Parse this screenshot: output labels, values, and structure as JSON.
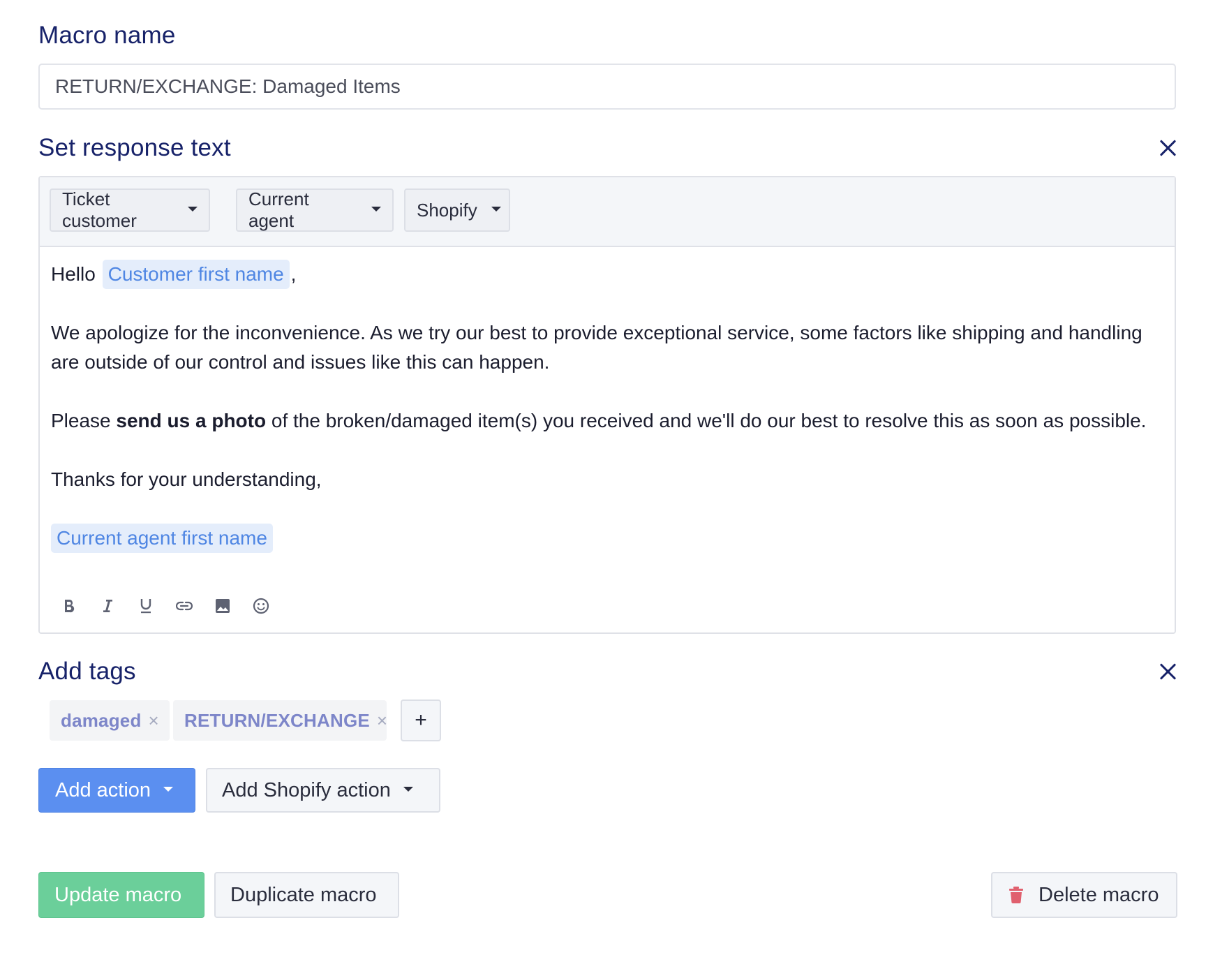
{
  "macro_name": {
    "title": "Macro name",
    "value": "RETURN/EXCHANGE: Damaged Items"
  },
  "response": {
    "title": "Set response text",
    "variable_menus": [
      "Ticket customer",
      "Current agent",
      "Shopify"
    ],
    "body": {
      "greeting": "Hello",
      "greeting_var": "Customer first name",
      "greeting_end": ",",
      "para1": "We apologize for the inconvenience. As we try our best to provide exceptional service, some factors like shipping and handling are outside of our control and issues like this can happen.",
      "para2_before": "Please ",
      "para2_bold": "send us a photo",
      "para2_after": " of the broken/damaged item(s) you received and we'll do our best to resolve this as soon as possible.",
      "closing": "Thanks for your understanding,",
      "signature_var": "Current agent first name"
    },
    "format_tools": [
      "bold-icon",
      "italic-icon",
      "underline-icon",
      "link-icon",
      "image-icon",
      "emoji-icon"
    ]
  },
  "tags": {
    "title": "Add tags",
    "items": [
      "damaged",
      "RETURN/EXCHANGE"
    ],
    "remove_glyph": "×",
    "add_glyph": "+"
  },
  "actions": {
    "add_action": "Add action",
    "add_shopify_action": "Add Shopify action"
  },
  "footer": {
    "update": "Update macro",
    "duplicate": "Duplicate macro",
    "delete": "Delete macro"
  },
  "colors": {
    "heading": "#172269",
    "primary": "#5b8ff0",
    "success": "#6bcf9a",
    "danger": "#e0606e",
    "variable_chip_bg": "#e4edfb",
    "variable_chip_text": "#4f86e3",
    "tag_text": "#7d86c9"
  }
}
